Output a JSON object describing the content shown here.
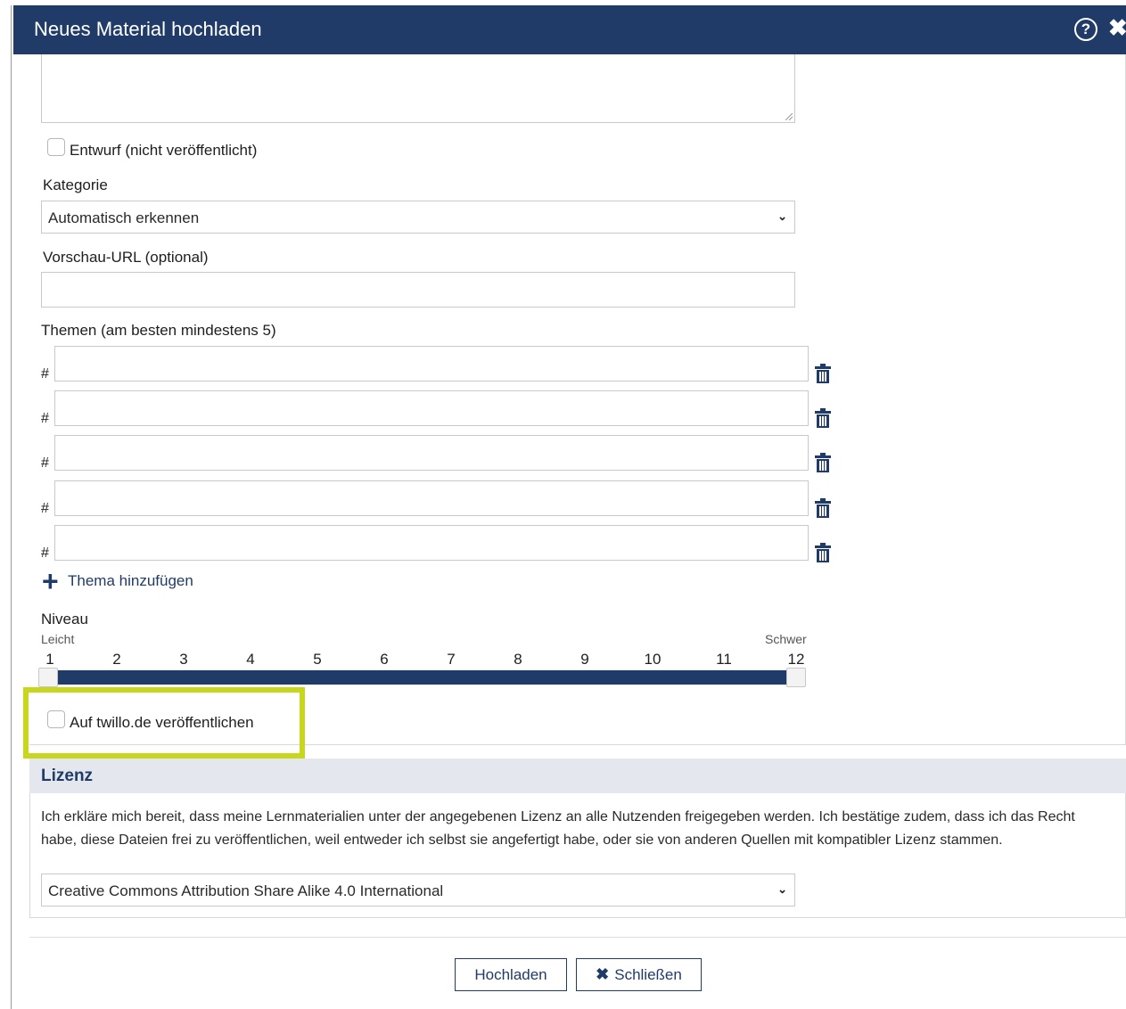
{
  "dialog": {
    "title": "Neues Material hochladen",
    "help_icon": "help-icon",
    "close_icon": "close-icon"
  },
  "form": {
    "draft_checkbox": {
      "label": "Entwurf (nicht veröffentlicht)",
      "checked": false
    },
    "category": {
      "label": "Kategorie",
      "value": "Automatisch erkennen"
    },
    "preview_url": {
      "label": "Vorschau-URL (optional)",
      "value": ""
    },
    "topics": {
      "label": "Themen (am besten mindestens 5)",
      "prefix": "#",
      "items": [
        "",
        "",
        "",
        "",
        ""
      ],
      "add_label": "Thema hinzufügen"
    },
    "level": {
      "label": "Niveau",
      "min_label": "Leicht",
      "max_label": "Schwer",
      "ticks": [
        "1",
        "2",
        "3",
        "4",
        "5",
        "6",
        "7",
        "8",
        "9",
        "10",
        "11",
        "12"
      ],
      "range": [
        1,
        12
      ]
    },
    "publish_checkbox": {
      "label": "Auf twillo.de veröffentlichen",
      "checked": false
    }
  },
  "license": {
    "header": "Lizenz",
    "text": "Ich erkläre mich bereit, dass meine Lernmaterialien unter der angegebenen Lizenz an alle Nutzenden freigegeben werden. Ich bestätige zudem, dass ich das Recht habe, diese Dateien frei zu veröffentlichen, weil entweder ich selbst sie angefertigt habe, oder sie von anderen Quellen mit kompatibler Lizenz stammen.",
    "value": "Creative Commons Attribution Share Alike 4.0 International"
  },
  "footer": {
    "upload_label": "Hochladen",
    "close_label": "Schließen"
  },
  "colors": {
    "primary": "#213b68",
    "highlight": "#c8d61e",
    "section_bg": "#e4e8ee"
  }
}
